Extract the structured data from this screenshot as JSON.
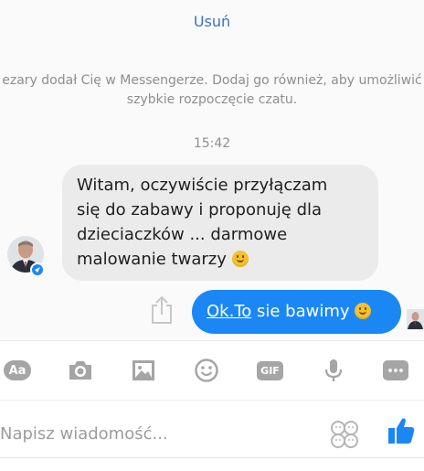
{
  "chat": {
    "remove_label": "Usuń",
    "notice_line1": "ezary dodał Cię w Messengerze. Dodaj go również, aby umożliwić",
    "notice_line2": "szybkie rozpoczęcie czatu.",
    "time": "15:42"
  },
  "messages": {
    "incoming": {
      "line1": "Witam, oczywiście przyłączam",
      "line2": "się do zabawy i proponuję dla",
      "line3": "dzieciaczków ...  darmowe",
      "line4": "malowanie twarzy"
    },
    "outgoing": {
      "link": "Ok.To",
      "text": " sie bawimy"
    }
  },
  "toolbar": {
    "aa_label": "Aa",
    "gif_label": "GIF",
    "icons": [
      "aa-icon",
      "camera-icon",
      "gallery-icon",
      "emoji-icon",
      "gif-icon",
      "microphone-icon",
      "more-icon"
    ]
  },
  "composer": {
    "placeholder": "Napisz wiadomość..."
  },
  "colors": {
    "accent": "#1b87f5",
    "link": "#3b6fd1",
    "incoming_bubble": "#ebebeb",
    "icon_gray": "#a5a5a5"
  }
}
